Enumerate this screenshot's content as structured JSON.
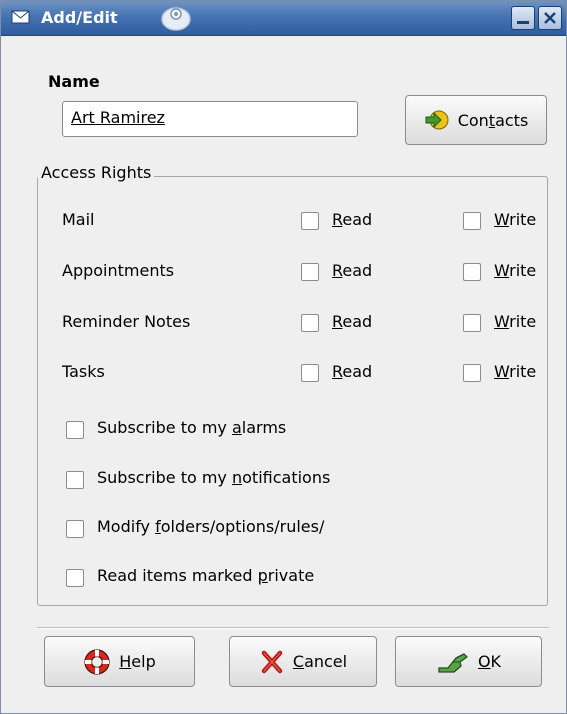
{
  "window": {
    "title": "Add/Edit",
    "icon": "envelope-icon",
    "controls": [
      "minimize-icon",
      "close-icon"
    ]
  },
  "name": {
    "label": "Name",
    "value": "Art  Ramirez"
  },
  "contacts_button": {
    "label_pre": "Con",
    "label_key": "t",
    "label_post": "acts",
    "icon": "arrow-right-icon"
  },
  "access_rights": {
    "title": "Access Rights",
    "rows": [
      {
        "label": "Mail",
        "read": "ead",
        "read_key": "R",
        "write": "rite",
        "write_key": "W"
      },
      {
        "label": "Appointments",
        "read": "ead",
        "read_key": "R",
        "write": "rite",
        "write_key": "W"
      },
      {
        "label": "Reminder Notes",
        "read": "ead",
        "read_key": "R",
        "write": "rite",
        "write_key": "W"
      },
      {
        "label": "Tasks",
        "read": "ead",
        "read_key": "R",
        "write": "rite",
        "write_key": "W"
      }
    ],
    "options": [
      {
        "pre": "Subscribe to my ",
        "key": "a",
        "post": "larms"
      },
      {
        "pre": "Subscribe to my ",
        "key": "n",
        "post": "otifications"
      },
      {
        "pre": "Modify ",
        "key": "f",
        "post": "olders/options/rules/"
      },
      {
        "pre": "Read items marked ",
        "key": "p",
        "post": "rivate"
      }
    ]
  },
  "buttons": {
    "help": {
      "key": "H",
      "post": "elp",
      "icon": "lifebuoy-icon"
    },
    "cancel": {
      "key": "C",
      "post": "ancel",
      "icon": "x-icon"
    },
    "ok": {
      "key": "O",
      "post": "K",
      "icon": "hand-icon"
    }
  },
  "colors": {
    "titlebar": "#4673b2",
    "window": "#efefef",
    "accent": "#2f5c9f"
  }
}
